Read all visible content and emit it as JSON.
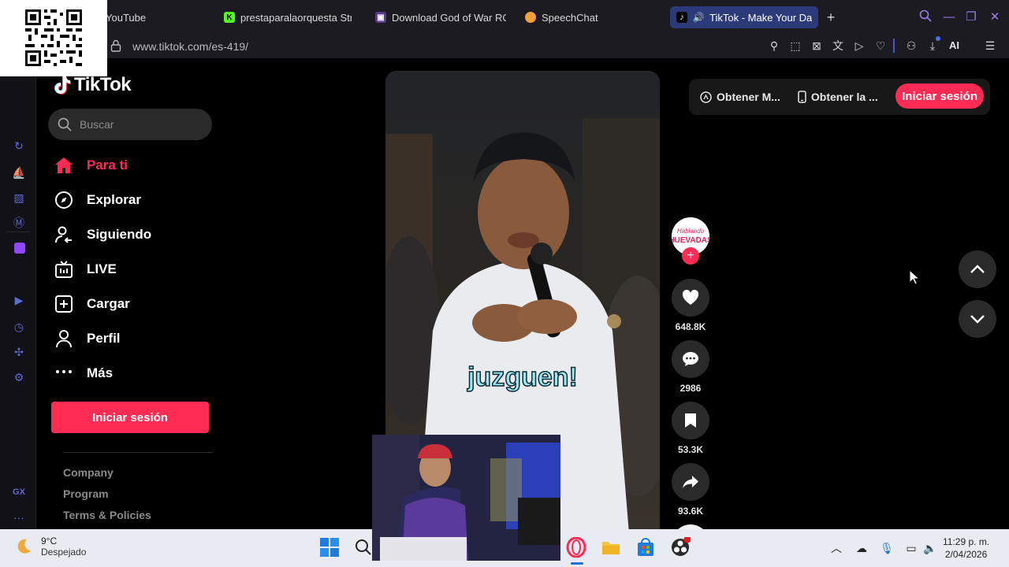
{
  "browser": {
    "tabs": [
      {
        "title": "YouTube",
        "favicon": "youtube-icon",
        "active": false
      },
      {
        "title": "prestaparalaorquesta Stre",
        "favicon": "kick-icon",
        "active": false
      },
      {
        "title": "Download God of War ROM",
        "favicon": "rom-site-icon",
        "active": false
      },
      {
        "title": "SpeechChat",
        "favicon": "speechchat-icon",
        "active": false
      },
      {
        "title": "TikTok - Make Your Day",
        "favicon": "tiktok-icon",
        "active": true
      }
    ],
    "url": "www.tiktok.com/es-419/",
    "ai_label": "AI"
  },
  "tiktok": {
    "logo_text": "TikTok",
    "search_placeholder": "Buscar",
    "nav": [
      {
        "label": "Para ti",
        "icon": "home-icon",
        "active": true
      },
      {
        "label": "Explorar",
        "icon": "compass-icon",
        "active": false
      },
      {
        "label": "Siguiendo",
        "icon": "following-icon",
        "active": false
      },
      {
        "label": "LIVE",
        "icon": "live-tv-icon",
        "active": false
      },
      {
        "label": "Cargar",
        "icon": "upload-icon",
        "active": false
      },
      {
        "label": "Perfil",
        "icon": "profile-icon",
        "active": false
      },
      {
        "label": "Más",
        "icon": "more-icon",
        "active": false
      }
    ],
    "login_label": "Iniciar sesión",
    "footer_links": [
      "Company",
      "Program",
      "Terms & Policies"
    ],
    "video": {
      "caption": "juzguen!",
      "avatar_text": "Hablando HUEVADAS"
    },
    "actions": {
      "likes": "648.8K",
      "comments": "2986",
      "saves": "53.3K",
      "shares": "93.6K"
    },
    "topbar": {
      "get_coins": "Obtener M...",
      "get_app": "Obtener la ...",
      "login": "Iniciar sesión"
    }
  },
  "taskbar": {
    "weather_temp": "9°C",
    "weather_desc": "Despejado",
    "time": "11:29 p. m.",
    "date": "2/04/2026"
  },
  "colors": {
    "accent": "#fe2c55",
    "gx_accent": "#5c6bd4",
    "caption": "#9be8f2"
  }
}
